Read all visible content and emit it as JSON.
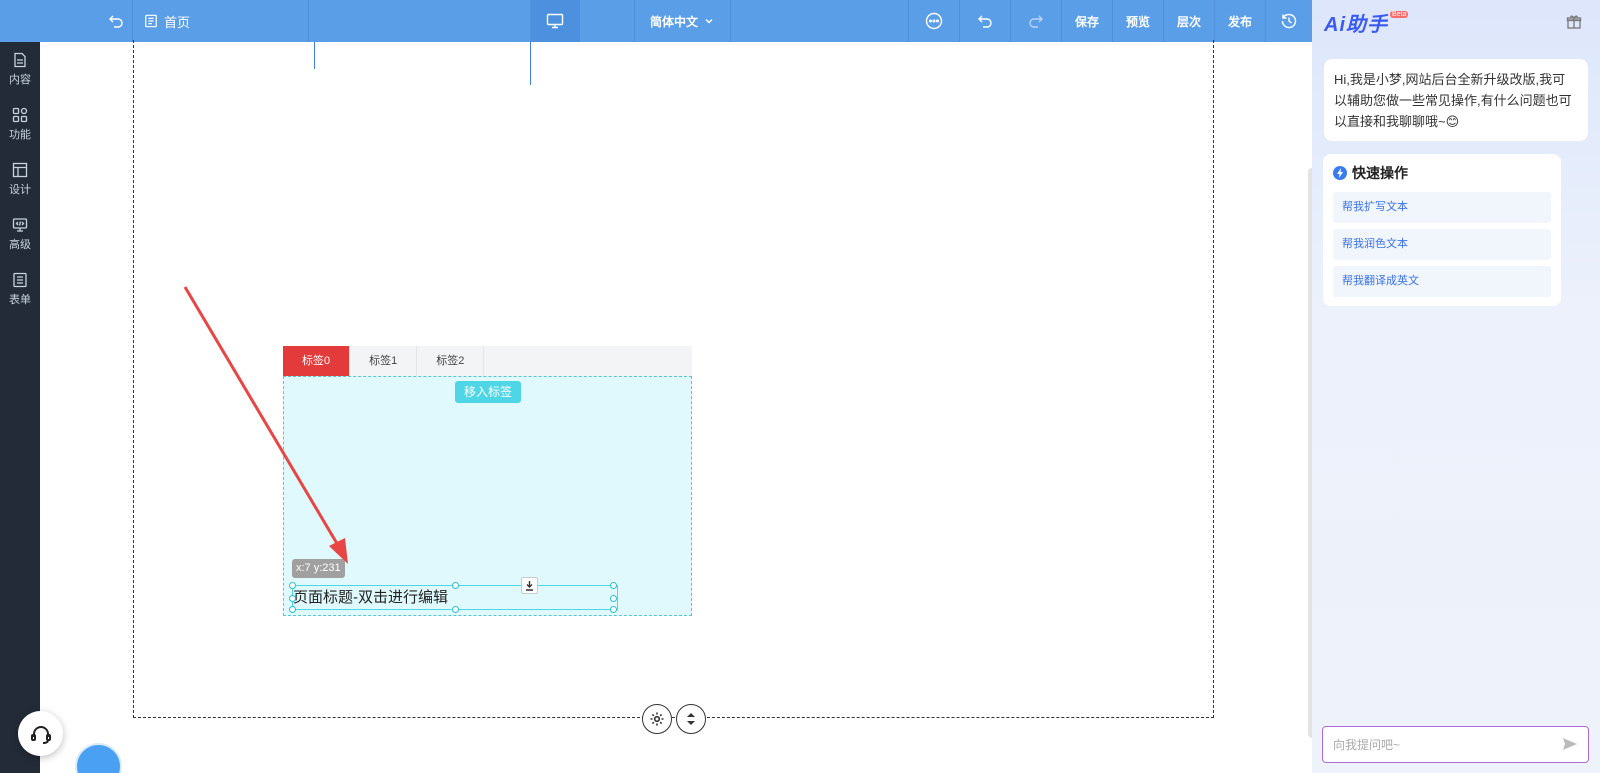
{
  "toolbar": {
    "page_name": "首页",
    "language": "简体中文",
    "save_label": "保存",
    "preview_label": "预览",
    "layers_label": "层次",
    "publish_label": "发布"
  },
  "sidebar": {
    "items": [
      {
        "label": "内容",
        "icon": "document-icon"
      },
      {
        "label": "功能",
        "icon": "grid-icon"
      },
      {
        "label": "设计",
        "icon": "layout-icon"
      },
      {
        "label": "高级",
        "icon": "code-icon"
      },
      {
        "label": "表单",
        "icon": "form-icon"
      }
    ]
  },
  "editor": {
    "tabs": [
      "标签0",
      "标签1",
      "标签2"
    ],
    "active_tab": 0,
    "move_in_label": "移入标签",
    "coord_label": "x:7 y:231",
    "title_text": "页面标题-双击进行编辑"
  },
  "ai": {
    "logo": "Ai助手",
    "beta": "Beta",
    "greeting": "Hi,我是小梦,网站后台全新升级改版,我可以辅助您做一些常见操作,有什么问题也可以直接和我聊聊哦~😊",
    "quick_title": "快速操作",
    "quick_actions": [
      "帮我扩写文本",
      "帮我润色文本",
      "帮我翻译成英文"
    ],
    "input_placeholder": "向我提问吧~"
  },
  "colors": {
    "toolbar": "#5b9ee8",
    "rail": "#232b38",
    "active_tab": "#e33b3b",
    "panel": "#dff9fc",
    "annotation_arrow": "#e84545"
  }
}
